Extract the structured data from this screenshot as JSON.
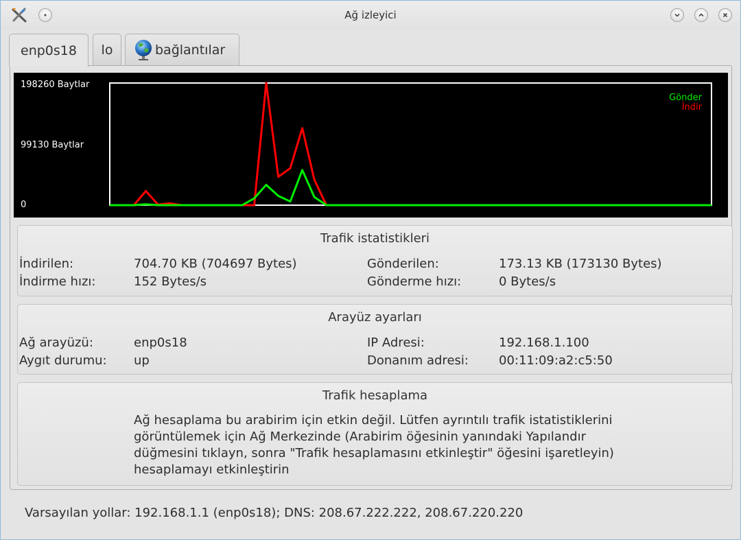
{
  "window": {
    "title": "Ağ izleyici",
    "app_icon": "network-monitor-icon",
    "buttons": [
      "minimize-icon",
      "maximize-icon",
      "close-icon"
    ]
  },
  "tabs": [
    {
      "label": "enp0s18",
      "active": true
    },
    {
      "label": "lo",
      "active": false
    },
    {
      "label": "bağlantılar",
      "icon": "globe-icon",
      "active": false
    }
  ],
  "chart_data": {
    "type": "line",
    "y_tick_labels": [
      "198260 Baytlar",
      "99130 Baytlar",
      "0"
    ],
    "ylim": [
      0,
      198260
    ],
    "grid": false,
    "legend_position": "top-right",
    "x": [
      0,
      1,
      2,
      3,
      4,
      5,
      6,
      7,
      8,
      9,
      10,
      11,
      12,
      13,
      14,
      15,
      16,
      17,
      18,
      19,
      20,
      21,
      22,
      23,
      24,
      25,
      26,
      27,
      28,
      29,
      30,
      31,
      32,
      33,
      34,
      35,
      36,
      37,
      38,
      39,
      40,
      41,
      42,
      43,
      44,
      45,
      46,
      47,
      48,
      49,
      50
    ],
    "series": [
      {
        "name": "Gönder",
        "color": "#00ee00",
        "values": [
          0,
          0,
          0,
          1500,
          0,
          0,
          0,
          0,
          0,
          0,
          0,
          0,
          11000,
          33000,
          15000,
          6000,
          57000,
          13000,
          0,
          0,
          0,
          0,
          0,
          0,
          0,
          0,
          0,
          0,
          0,
          0,
          0,
          0,
          0,
          0,
          0,
          0,
          0,
          0,
          0,
          0,
          0,
          0,
          0,
          0,
          0,
          0,
          0,
          0,
          0,
          0,
          0
        ]
      },
      {
        "name": "İndir",
        "color": "#ff0000",
        "values": [
          0,
          0,
          0,
          23000,
          1000,
          3000,
          0,
          0,
          0,
          0,
          0,
          0,
          0,
          198260,
          46000,
          60000,
          125000,
          41000,
          0,
          0,
          0,
          0,
          0,
          0,
          0,
          0,
          0,
          0,
          0,
          0,
          0,
          0,
          0,
          0,
          0,
          0,
          0,
          0,
          0,
          0,
          0,
          0,
          0,
          0,
          0,
          0,
          0,
          0,
          0,
          0,
          0
        ]
      }
    ]
  },
  "traffic": {
    "title": "Trafik istatistikleri",
    "downloaded_label": "İndirilen:",
    "downloaded_value": "704.70 KB (704697 Bytes)",
    "download_rate_label": "İndirme hızı:",
    "download_rate_value": "152 Bytes/s",
    "uploaded_label": "Gönderilen:",
    "uploaded_value": "173.13 KB (173130 Bytes)",
    "upload_rate_label": "Gönderme hızı:",
    "upload_rate_value": "0 Bytes/s"
  },
  "interface": {
    "title": "Arayüz ayarları",
    "iface_label": "Ağ arayüzü:",
    "iface_value": "enp0s18",
    "state_label": "Aygıt durumu:",
    "state_value": "up",
    "ip_label": "IP Adresi:",
    "ip_value": "192.168.1.100",
    "mac_label": "Donanım adresi:",
    "mac_value": "00:11:09:a2:c5:50"
  },
  "accounting": {
    "title": "Trafik hesaplama",
    "message": "Ağ hesaplama bu arabirim için etkin değil. Lütfen ayrıntılı trafik istatistiklerini görüntülemek için Ağ Merkezinde (Arabirim öğesinin yanındaki Yapılandır düğmesini tıklayn, sonra \"Trafik hesaplamasını etkinleştir\" öğesini işaretleyin) hesaplamayı etkinleştirin"
  },
  "statusbar": {
    "text": "Varsayılan yollar: 192.168.1.1 (enp0s18); DNS: 208.67.222.222, 208.67.220.220"
  }
}
